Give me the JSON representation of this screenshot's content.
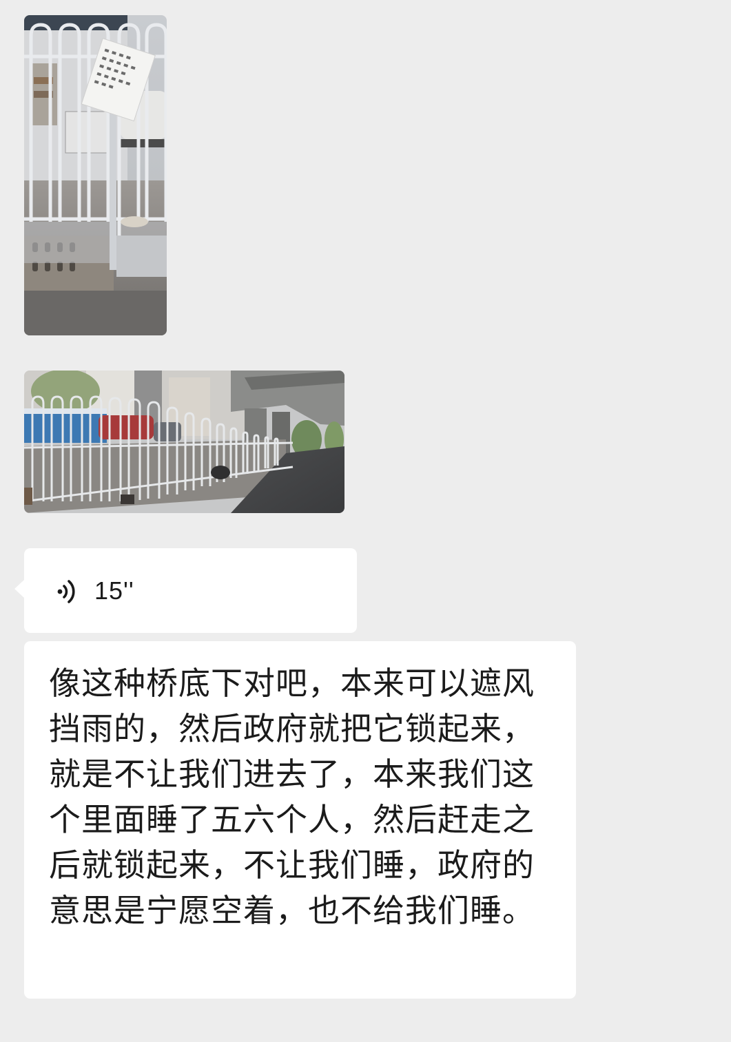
{
  "chat": {
    "messages": [
      {
        "type": "image",
        "orientation": "portrait",
        "subject": "locked metal gate with a notice paper"
      },
      {
        "type": "image",
        "orientation": "landscape",
        "subject": "fenced area under an elevated bridge"
      },
      {
        "type": "voice",
        "icon": "voice-wave-icon",
        "duration": "15''"
      },
      {
        "type": "text",
        "text": "像这种桥底下对吧，本来可以遮风挡雨的，然后政府就把它锁起来，就是不让我们进去了，本来我们这个里面睡了五六个人，然后赶走之后就锁起来，不让我们睡，政府的意思是宁愿空着，也不给我们睡。"
      }
    ]
  },
  "colors": {
    "background": "#ededed",
    "bubble": "#ffffff",
    "text": "#1b1b1b"
  }
}
